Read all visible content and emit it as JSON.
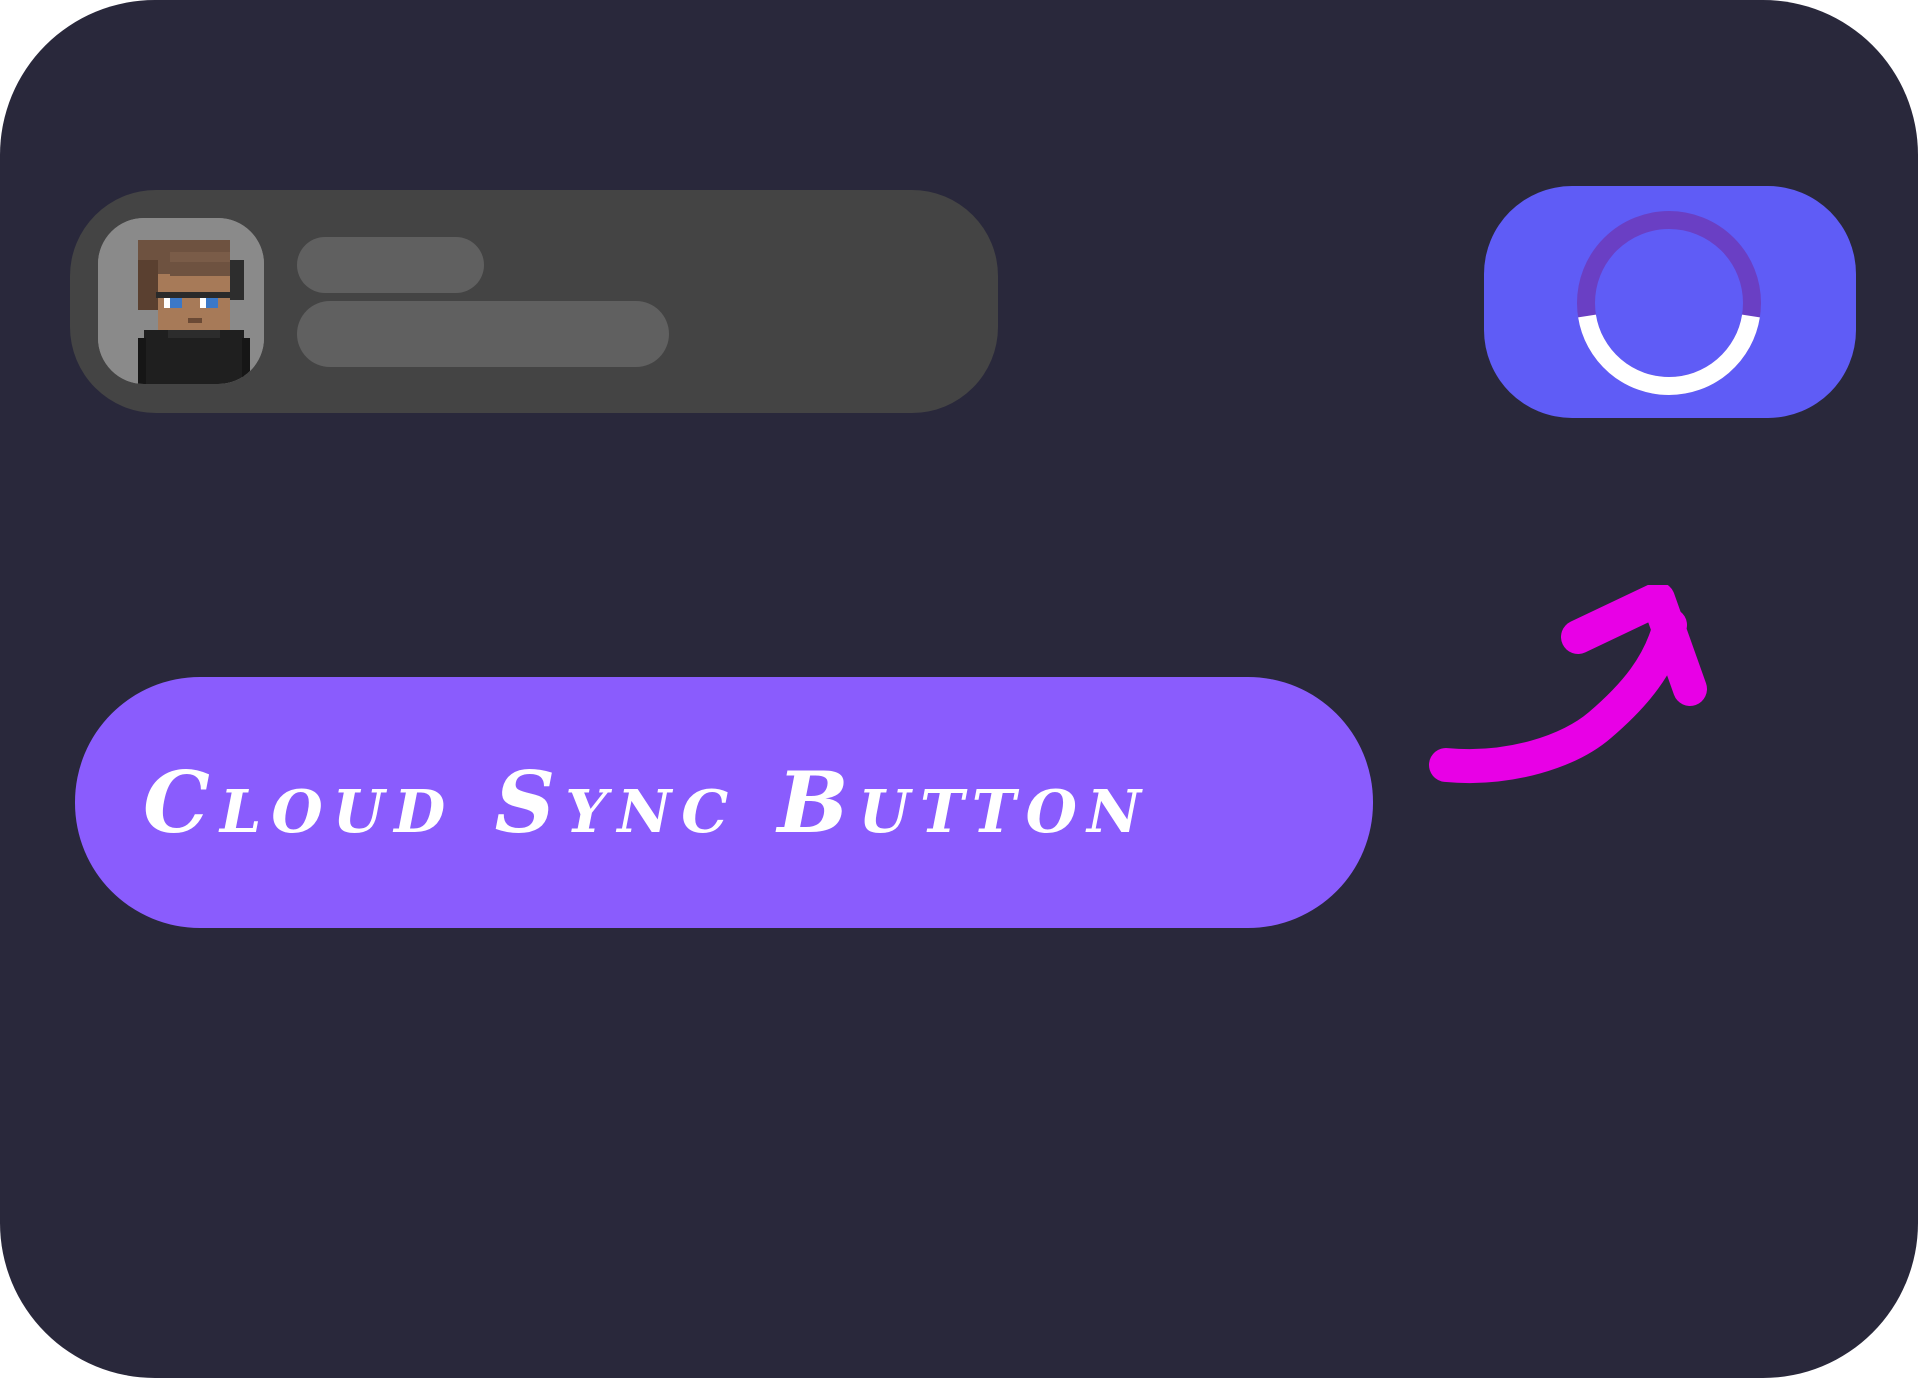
{
  "colors": {
    "frame_bg": "#29283b",
    "card_bg": "#444444",
    "skeleton": "#606060",
    "sync_button_bg": "#5f5cf6",
    "spinner_track": "#6a3fc4",
    "spinner_progress": "#ffffff",
    "label_pill_bg": "#8a5cfd",
    "arrow": "#e800e6"
  },
  "profile_card": {
    "avatar_icon": "pixel-character-avatar",
    "name_placeholder": "skeleton-line",
    "detail_placeholder": "skeleton-line"
  },
  "sync_button": {
    "icon": "loading-spinner-icon",
    "progress_fraction": 0.45
  },
  "annotation": {
    "label": "Cloud Sync Button",
    "pointer_icon": "curved-arrow-icon"
  }
}
